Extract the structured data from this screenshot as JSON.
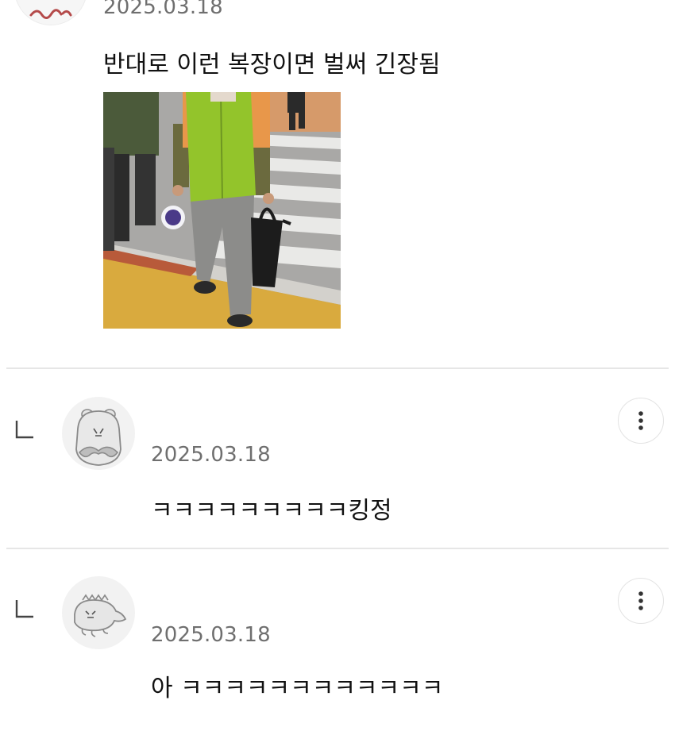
{
  "comments": [
    {
      "date": "2025.03.18",
      "text": "반대로 이런 복장이면 벌써 긴장됨",
      "has_photo": true
    }
  ],
  "replies": [
    {
      "date": "2025.03.18",
      "text": "ㅋㅋㅋㅋㅋㅋㅋㅋㅋ킹정",
      "avatar_icon": "hamster-mustache-avatar-icon",
      "menu_icon": "more-vertical-icon"
    },
    {
      "date": "2025.03.18",
      "text": "아 ㅋㅋㅋㅋㅋㅋㅋㅋㅋㅋㅋㅋ",
      "avatar_icon": "lizard-avatar-icon",
      "menu_icon": "more-vertical-icon"
    }
  ],
  "colors": {
    "date_text": "#6f6f6f",
    "body_text": "#111111",
    "divider": "#e6e6e6"
  }
}
